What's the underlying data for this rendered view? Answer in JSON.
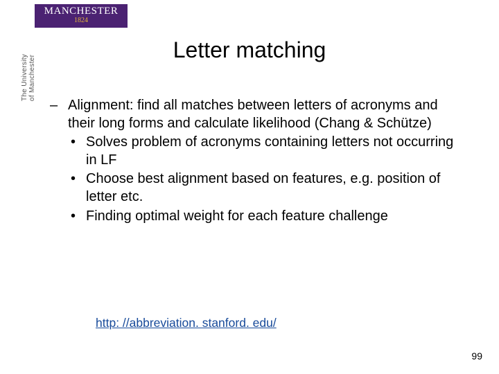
{
  "logo": {
    "name": "MANCHESTER",
    "year": "1824",
    "vertical": "The University\nof Manchester"
  },
  "title": "Letter matching",
  "body": {
    "dash_mark": "–",
    "main": "Alignment: find all matches between letters of acronyms and their long forms and calculate likelihood (Chang & Schütze)",
    "bullets": [
      "Solves problem of acronyms containing letters not occurring in LF",
      "Choose best alignment based on features, e.g. position of letter etc.",
      "Finding optimal weight for each feature challenge"
    ],
    "bullet_mark": "•"
  },
  "link": "http: //abbreviation. stanford. edu/",
  "page_number": "99"
}
